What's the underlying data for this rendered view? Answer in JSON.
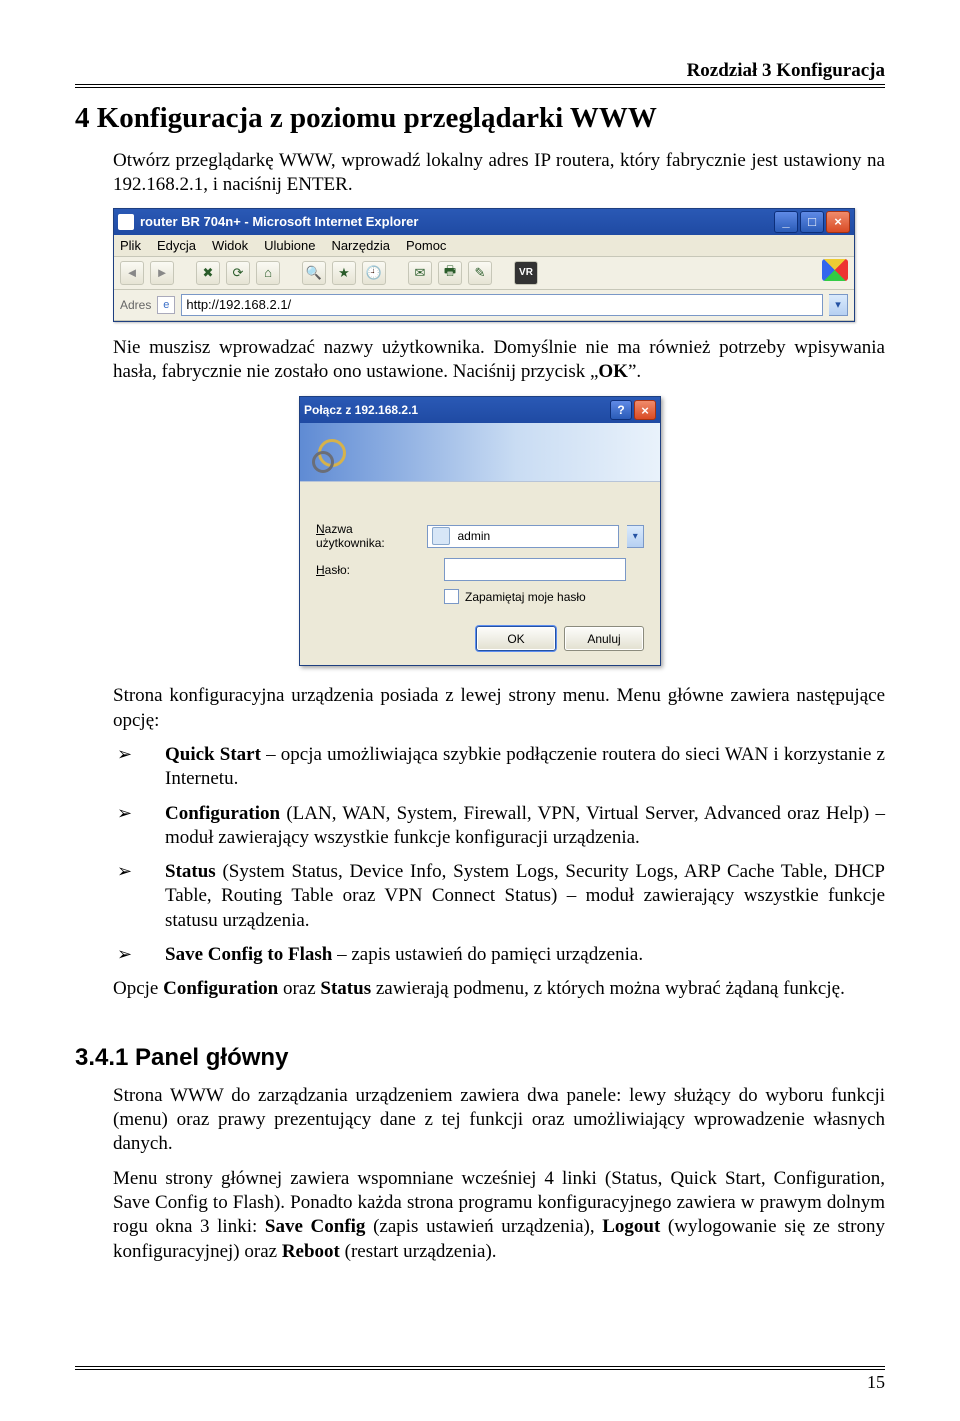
{
  "chapter_header": "Rozdział 3 Konfiguracja",
  "title": "4 Konfiguracja z poziomu przeglądarki WWW",
  "intro": "Otwórz przeglądarkę WWW, wprowadź lokalny adres IP routera, który fabrycznie jest ustawiony na 192.168.2.1, i naciśnij ENTER.",
  "browser": {
    "window_title": "router BR 704n+ - Microsoft Internet Explorer",
    "menubar": [
      "Plik",
      "Edycja",
      "Widok",
      "Ulubione",
      "Narzędzia",
      "Pomoc"
    ],
    "addr_label": "Adres",
    "url": "http://192.168.2.1/"
  },
  "after_browser_para": [
    "Nie muszisz wprowadzać nazwy użytkownika. Domyślnie nie ma również potrzeby wpisywania hasła, fabrycznie nie zostało ono ustawione. Naciśnij przycisk „",
    "OK",
    "”."
  ],
  "auth_dialog": {
    "title": "Połącz z 192.168.2.1",
    "username_label": "Nazwa użytkownika:",
    "username_value": "admin",
    "password_label": "Hasło:",
    "password_value": "",
    "remember_label": "Zapamiętaj moje hasło",
    "ok": "OK",
    "cancel": "Anuluj"
  },
  "after_dialog_para": "Strona konfiguracyjna urządzenia posiada z lewej strony menu. Menu główne zawiera następujące opcję:",
  "bullets": [
    {
      "b": "Quick Start",
      "rest": " – opcja umożliwiająca szybkie  podłączenie routera do sieci WAN i korzystanie z Internetu."
    },
    {
      "b": "Configuration",
      "rest": " (LAN, WAN, System, Firewall, VPN, Virtual Server, Advanced oraz Help) – moduł zawierający wszystkie funkcje konfiguracji urządzenia."
    },
    {
      "b": "Status",
      "rest": " (System Status, Device Info, System Logs, Security Logs, ARP Cache Table, DHCP Table, Routing Table oraz VPN Connect Status) – moduł zawierający wszystkie funkcje statusu urządzenia."
    },
    {
      "b": "Save Config to Flash",
      "rest": " – zapis ustawień do pamięci urządzenia."
    }
  ],
  "options_note": [
    "Opcje ",
    "Configuration",
    " oraz ",
    "Status",
    " zawierają podmenu, z których można wybrać żądaną funkcję."
  ],
  "subheading": "3.4.1 Panel główny",
  "panel_para1": "Strona WWW do zarządzania urządzeniem zawiera dwa panele: lewy służący do wyboru funkcji (menu) oraz prawy prezentujący dane z tej funkcji oraz umożliwiający wprowadzenie własnych danych.",
  "panel_para2": [
    "Menu strony głównej zawiera wspomniane wcześniej 4 linki (Status, Quick Start, Configuration, Save Config to Flash). Ponadto każda strona programu konfiguracyjnego zawiera w prawym dolnym rogu okna 3 linki: ",
    "Save Config",
    " (zapis ustawień urządzenia), ",
    "Logout",
    " (wylogowanie się ze strony konfiguracyjnej) oraz ",
    "Reboot",
    " (restart urządzenia)."
  ],
  "page_number": "15"
}
